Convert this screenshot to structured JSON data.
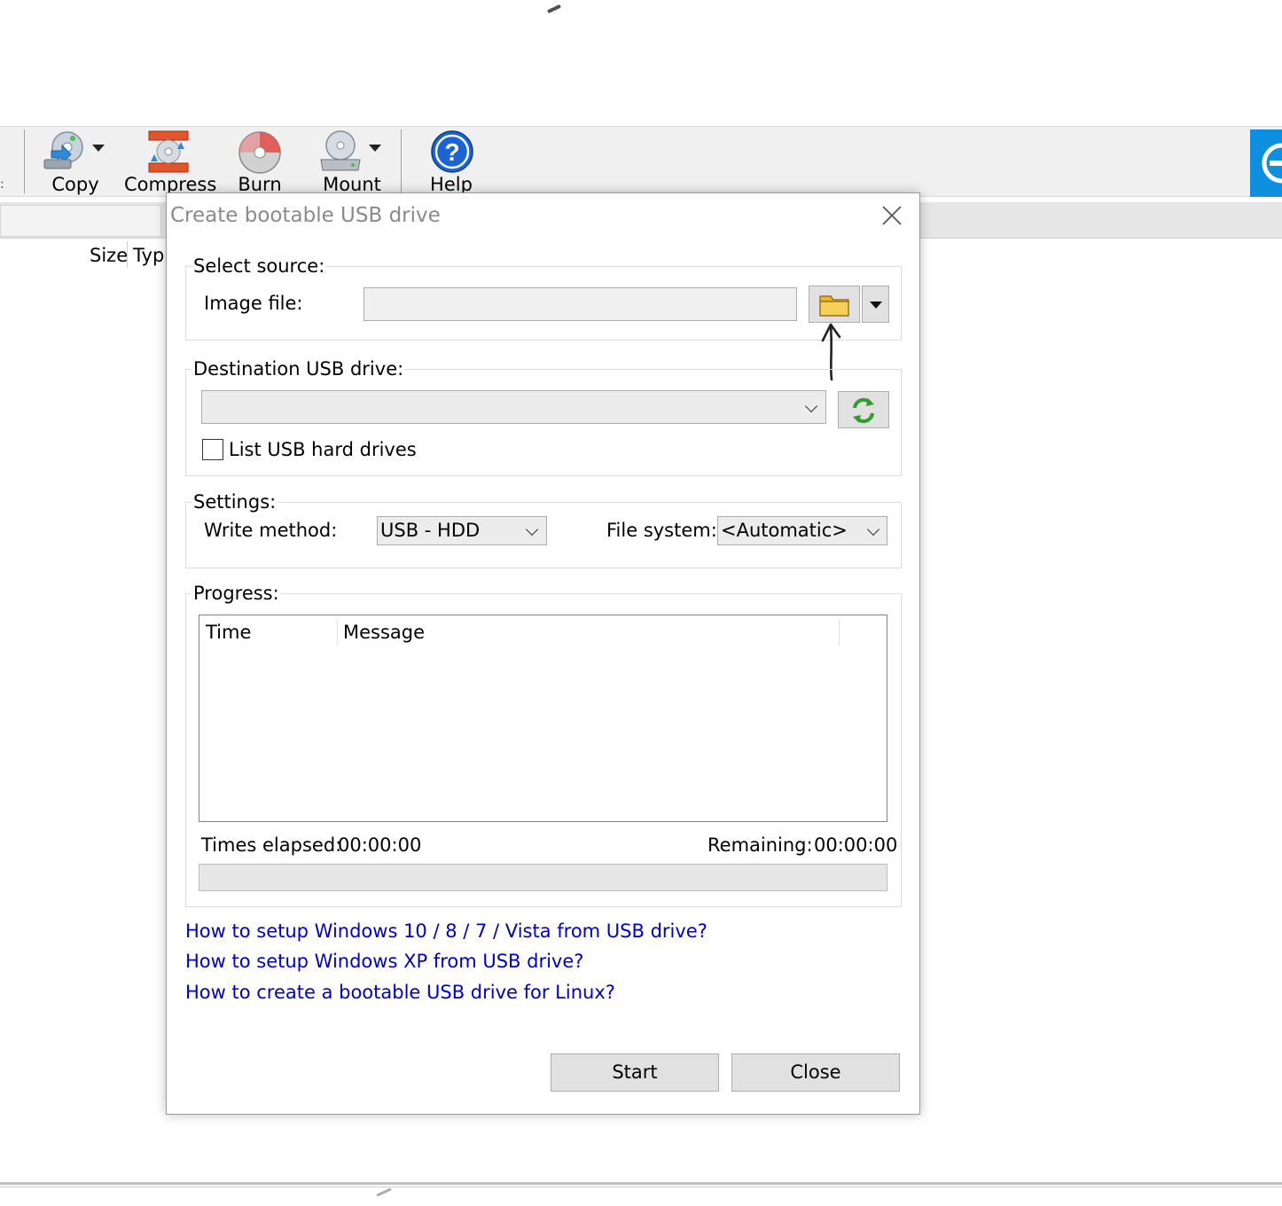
{
  "toolbar": {
    "items": [
      {
        "label": "Copy",
        "icon": "copy-disc-icon",
        "has_dropdown": true
      },
      {
        "label": "Compress",
        "icon": "compress-icon",
        "has_dropdown": false
      },
      {
        "label": "Burn",
        "icon": "burn-disc-icon",
        "has_dropdown": false
      },
      {
        "label": "Mount",
        "icon": "mount-drive-icon",
        "has_dropdown": true
      },
      {
        "label": "Help",
        "icon": "help-icon",
        "has_dropdown": false
      }
    ]
  },
  "file_list": {
    "columns": [
      "Size",
      "Typ"
    ]
  },
  "dialog": {
    "title": "Create bootable USB drive",
    "select_source": {
      "group_label": "Select source:",
      "image_file_label": "Image file:",
      "image_file_value": ""
    },
    "destination": {
      "group_label": "Destination USB drive:",
      "selected_drive": "",
      "list_usb_hard_drives_label": "List USB hard drives",
      "list_usb_hard_drives_checked": false
    },
    "settings": {
      "group_label": "Settings:",
      "write_method_label": "Write method:",
      "write_method_value": "USB - HDD",
      "file_system_label": "File system:",
      "file_system_value": "<Automatic>"
    },
    "progress": {
      "group_label": "Progress:",
      "columns": [
        "Time",
        "Message"
      ],
      "rows": [],
      "times_elapsed_label": "Times elapsed:",
      "times_elapsed_value": "00:00:00",
      "remaining_label": "Remaining:",
      "remaining_value": "00:00:00",
      "progress_fraction": 0
    },
    "links": [
      "How to setup Windows 10 / 8 / 7 / Vista from USB drive?",
      "How to setup Windows XP from USB drive?",
      "How to create a bootable USB drive for Linux?"
    ],
    "buttons": {
      "start": "Start",
      "close": "Close"
    }
  },
  "colors": {
    "link": "#0000cc",
    "title_text": "#8a8a8a",
    "accent_blue": "#0f8fdf"
  }
}
